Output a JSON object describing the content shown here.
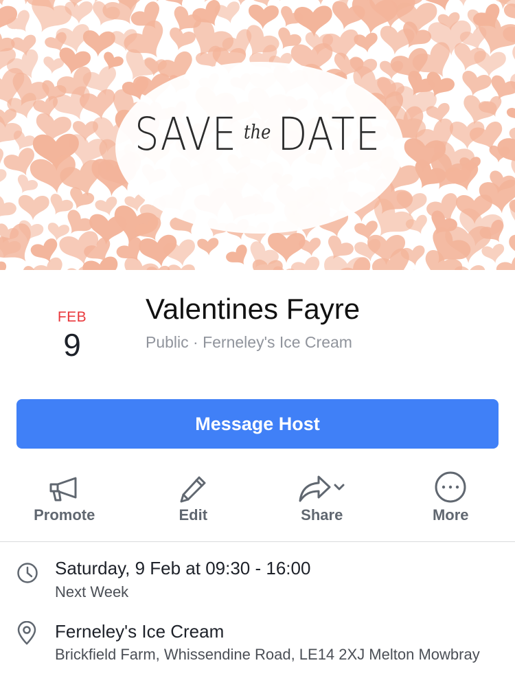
{
  "cover": {
    "text_save": "SAVE",
    "text_the": "the",
    "text_date": "DATE",
    "heart_color": "#f3b49a"
  },
  "event": {
    "month": "FEB",
    "day": "9",
    "title": "Valentines Fayre",
    "meta": "Public · Ferneley's Ice Cream"
  },
  "primary_button": {
    "label": "Message Host",
    "color": "#4080f7"
  },
  "actions": [
    {
      "label": "Promote",
      "icon": "megaphone-icon"
    },
    {
      "label": "Edit",
      "icon": "pencil-icon"
    },
    {
      "label": "Share",
      "icon": "share-icon"
    },
    {
      "label": "More",
      "icon": "more-icon"
    }
  ],
  "details": {
    "time": {
      "main": "Saturday, 9 Feb at 09:30 - 16:00",
      "sub": "Next Week",
      "icon": "clock-icon"
    },
    "location": {
      "main": "Ferneley's Ice Cream",
      "sub": "Brickfield Farm, Whissendine Road, LE14 2XJ Melton Mowbray",
      "icon": "location-pin-icon"
    }
  }
}
